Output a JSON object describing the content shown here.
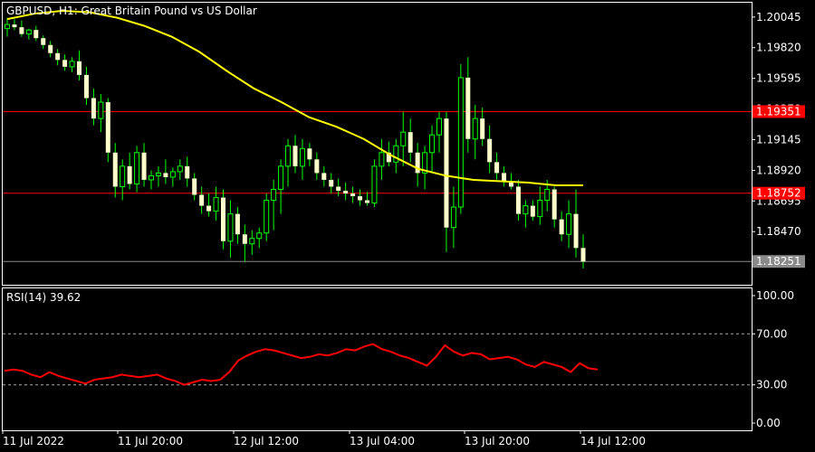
{
  "chart_data": {
    "type": "candlestick",
    "title": "GBPUSD, H1:  Great Britain Pound vs US Dollar",
    "price_ticks": [
      "1.20045",
      "1.19820",
      "1.19595",
      "1.19370",
      "1.19145",
      "1.18920",
      "1.18695",
      "1.18470",
      "1.18251"
    ],
    "ylim": [
      1.1808,
      1.2015
    ],
    "x_labels": [
      "11 Jul 2022",
      "11 Jul 20:00",
      "12 Jul 12:00",
      "13 Jul 04:00",
      "13 Jul 20:00",
      "14 Jul 12:00"
    ],
    "horizontal_lines": [
      {
        "label": "1.19351",
        "value": 1.19351,
        "color": "#ff0000"
      },
      {
        "label": "1.18752",
        "value": 1.18752,
        "color": "#ff0000"
      },
      {
        "label": "1.18251",
        "value": 1.18251,
        "color": "#8a8a8a"
      }
    ],
    "moving_average": {
      "color": "#ffff00",
      "points": [
        [
          0,
          1.2003
        ],
        [
          5,
          1.2007
        ],
        [
          10,
          1.2009
        ],
        [
          15,
          1.2008
        ],
        [
          20,
          1.2004
        ],
        [
          25,
          1.1998
        ],
        [
          30,
          1.199
        ],
        [
          35,
          1.1979
        ],
        [
          40,
          1.1965
        ],
        [
          45,
          1.1952
        ],
        [
          50,
          1.1942
        ],
        [
          55,
          1.1931
        ],
        [
          60,
          1.1924
        ],
        [
          65,
          1.1915
        ],
        [
          70,
          1.1903
        ],
        [
          75,
          1.1893
        ],
        [
          80,
          1.1888
        ],
        [
          85,
          1.1885
        ],
        [
          90,
          1.1884
        ],
        [
          95,
          1.1883
        ],
        [
          100,
          1.1881
        ],
        [
          105,
          1.1881
        ]
      ]
    },
    "candles": [
      [
        1.1996,
        1.2004,
        1.199,
        1.1999
      ],
      [
        1.1999,
        1.2003,
        1.1995,
        1.1997
      ],
      [
        1.1997,
        1.2002,
        1.199,
        1.1992
      ],
      [
        1.1992,
        1.1996,
        1.1988,
        1.1995
      ],
      [
        1.1995,
        1.1998,
        1.1987,
        1.1989
      ],
      [
        1.1989,
        1.1991,
        1.1981,
        1.1984
      ],
      [
        1.1984,
        1.1987,
        1.1975,
        1.1978
      ],
      [
        1.1978,
        1.1981,
        1.1969,
        1.1973
      ],
      [
        1.1973,
        1.1977,
        1.1965,
        1.1968
      ],
      [
        1.1968,
        1.1975,
        1.1964,
        1.1972
      ],
      [
        1.1972,
        1.198,
        1.1958,
        1.1962
      ],
      [
        1.1962,
        1.1968,
        1.194,
        1.1945
      ],
      [
        1.1945,
        1.1952,
        1.1925,
        1.193
      ],
      [
        1.193,
        1.1948,
        1.192,
        1.1942
      ],
      [
        1.1942,
        1.1945,
        1.1898,
        1.1905
      ],
      [
        1.1905,
        1.1912,
        1.1872,
        1.188
      ],
      [
        1.188,
        1.19,
        1.187,
        1.1895
      ],
      [
        1.1895,
        1.1905,
        1.1878,
        1.1882
      ],
      [
        1.1882,
        1.191,
        1.1876,
        1.1905
      ],
      [
        1.1905,
        1.1912,
        1.188,
        1.1885
      ],
      [
        1.1885,
        1.1892,
        1.1878,
        1.1888
      ],
      [
        1.1888,
        1.1895,
        1.188,
        1.189
      ],
      [
        1.189,
        1.19,
        1.1882,
        1.1887
      ],
      [
        1.1887,
        1.1894,
        1.188,
        1.1891
      ],
      [
        1.1891,
        1.19,
        1.1885,
        1.1895
      ],
      [
        1.1895,
        1.1902,
        1.188,
        1.1886
      ],
      [
        1.1886,
        1.189,
        1.187,
        1.1874
      ],
      [
        1.1874,
        1.188,
        1.186,
        1.1866
      ],
      [
        1.1866,
        1.1875,
        1.1858,
        1.1862
      ],
      [
        1.1862,
        1.188,
        1.1855,
        1.1872
      ],
      [
        1.1872,
        1.1878,
        1.1834,
        1.184
      ],
      [
        1.184,
        1.187,
        1.1828,
        1.186
      ],
      [
        1.186,
        1.1865,
        1.1838,
        1.1845
      ],
      [
        1.1845,
        1.1852,
        1.1825,
        1.1838
      ],
      [
        1.1838,
        1.1848,
        1.183,
        1.1842
      ],
      [
        1.1842,
        1.185,
        1.1835,
        1.1846
      ],
      [
        1.1846,
        1.1875,
        1.184,
        1.187
      ],
      [
        1.187,
        1.1885,
        1.1848,
        1.1878
      ],
      [
        1.1878,
        1.19,
        1.186,
        1.1895
      ],
      [
        1.1895,
        1.1915,
        1.188,
        1.191
      ],
      [
        1.191,
        1.1918,
        1.189,
        1.1895
      ],
      [
        1.1895,
        1.1915,
        1.1885,
        1.1908
      ],
      [
        1.1908,
        1.1912,
        1.1895,
        1.19
      ],
      [
        1.19,
        1.1905,
        1.1885,
        1.189
      ],
      [
        1.189,
        1.1895,
        1.188,
        1.1885
      ],
      [
        1.1885,
        1.189,
        1.1875,
        1.188
      ],
      [
        1.188,
        1.1886,
        1.1873,
        1.1877
      ],
      [
        1.1877,
        1.1883,
        1.187,
        1.1875
      ],
      [
        1.1875,
        1.188,
        1.1868,
        1.1873
      ],
      [
        1.1873,
        1.1878,
        1.1866,
        1.187
      ],
      [
        1.187,
        1.1876,
        1.1866,
        1.1868
      ],
      [
        1.1868,
        1.19,
        1.1865,
        1.1895
      ],
      [
        1.1895,
        1.1915,
        1.1885,
        1.1905
      ],
      [
        1.1905,
        1.1913,
        1.1895,
        1.1898
      ],
      [
        1.1898,
        1.1915,
        1.189,
        1.191
      ],
      [
        1.191,
        1.1935,
        1.1895,
        1.192
      ],
      [
        1.192,
        1.193,
        1.1898,
        1.1905
      ],
      [
        1.1905,
        1.1912,
        1.188,
        1.189
      ],
      [
        1.189,
        1.191,
        1.1878,
        1.1905
      ],
      [
        1.1905,
        1.1925,
        1.189,
        1.1918
      ],
      [
        1.1918,
        1.1935,
        1.1905,
        1.193
      ],
      [
        1.193,
        1.1935,
        1.1832,
        1.185
      ],
      [
        1.185,
        1.188,
        1.1835,
        1.1865
      ],
      [
        1.1865,
        1.197,
        1.186,
        1.196
      ],
      [
        1.196,
        1.1975,
        1.1905,
        1.1915
      ],
      [
        1.1915,
        1.194,
        1.19,
        1.193
      ],
      [
        1.193,
        1.1938,
        1.191,
        1.1915
      ],
      [
        1.1915,
        1.1925,
        1.189,
        1.1898
      ],
      [
        1.1898,
        1.1905,
        1.1885,
        1.189
      ],
      [
        1.189,
        1.1895,
        1.188,
        1.1884
      ],
      [
        1.1884,
        1.189,
        1.1878,
        1.188
      ],
      [
        1.188,
        1.1885,
        1.1855,
        1.186
      ],
      [
        1.186,
        1.187,
        1.185,
        1.1866
      ],
      [
        1.1866,
        1.187,
        1.1855,
        1.1858
      ],
      [
        1.1858,
        1.188,
        1.1852,
        1.187
      ],
      [
        1.187,
        1.1885,
        1.1862,
        1.1878
      ],
      [
        1.1878,
        1.188,
        1.185,
        1.1856
      ],
      [
        1.1856,
        1.1862,
        1.184,
        1.1845
      ],
      [
        1.1845,
        1.187,
        1.1835,
        1.186
      ],
      [
        1.186,
        1.1878,
        1.1828,
        1.1835
      ],
      [
        1.1835,
        1.1845,
        1.182,
        1.1825
      ]
    ],
    "rsi": {
      "label": "RSI(14) 39.62",
      "value": 39.62,
      "ticks": [
        "100.00",
        "70.00",
        "30.00",
        "0.00"
      ],
      "levels": [
        70,
        30
      ],
      "ylim": [
        0,
        100
      ],
      "color": "#ff0000",
      "values": [
        41,
        42,
        41,
        38,
        36,
        40,
        37,
        35,
        33,
        31,
        34,
        35,
        36,
        38,
        37,
        36,
        37,
        38,
        35,
        33,
        30,
        32,
        34,
        33,
        34,
        40,
        49,
        53,
        56,
        58,
        57,
        55,
        53,
        51,
        52,
        54,
        53,
        55,
        58,
        57,
        60,
        62,
        58,
        56,
        53,
        51,
        48,
        45,
        52,
        61,
        56,
        53,
        55,
        54,
        50,
        51,
        52,
        50,
        46,
        44,
        48,
        46,
        44,
        40,
        47,
        43,
        42
      ]
    }
  }
}
